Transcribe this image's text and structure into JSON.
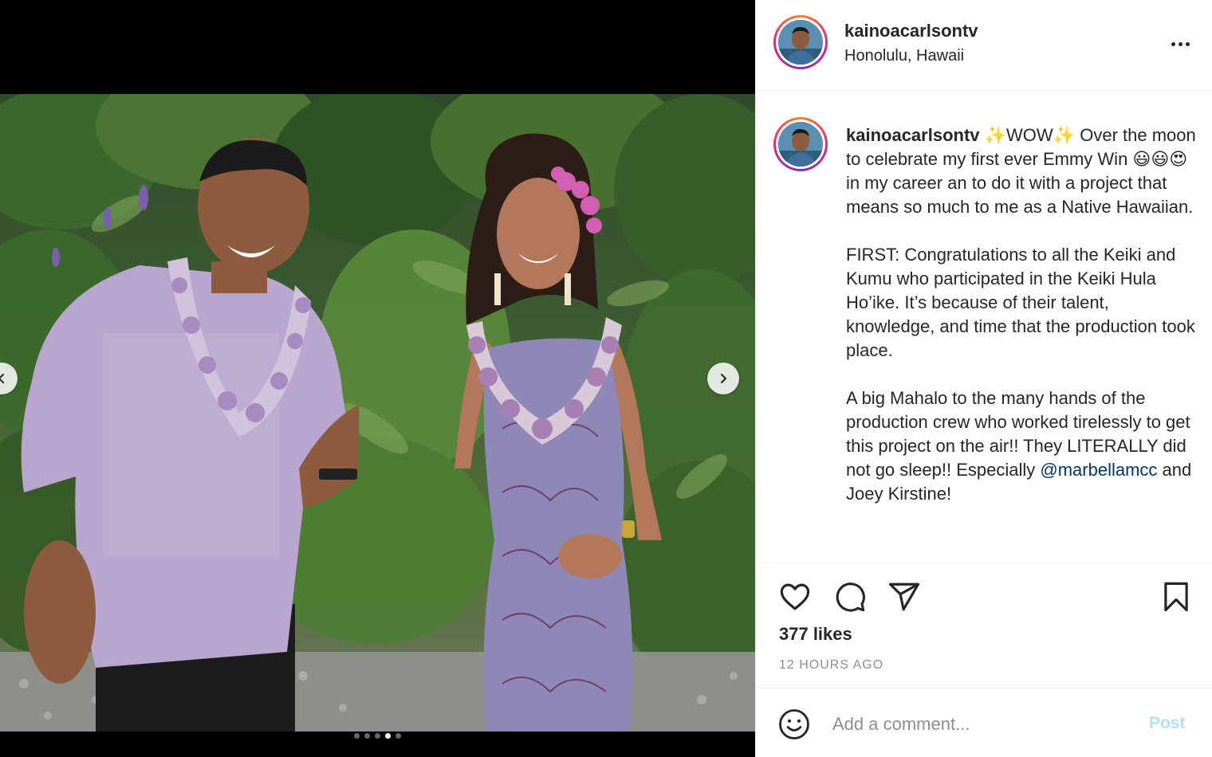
{
  "post": {
    "username": "kainoacarlsontv",
    "location": "Honolulu, Hawaii",
    "media": {
      "carousel_count": 5,
      "active_index": 3
    },
    "caption": {
      "author": "kainoacarlsontv",
      "sparkle": "✨",
      "line1_word": "WOW",
      "line1_rest": " Over the moon to celebrate my first ever Emmy Win ",
      "line1_emojis": "😃😃😍",
      "line1_end": " in my career an to do it with a project that means so much to me as a Native Hawaiian.",
      "para2": "FIRST: Congratulations to all the Keiki and Kumu who participated in the Keiki Hula Ho’ike. It’s because of their talent, knowledge, and time that the production took place.",
      "para3_start": "A big Mahalo to the many hands of the production crew who worked tirelessly to get this project on the air!! They LITERALLY did not go sleep!! Especially ",
      "mention": "@marbellamcc",
      "para3_end": " and Joey Kirstine!"
    },
    "likes": "377 likes",
    "time_ago": "12 HOURS AGO",
    "comment": {
      "placeholder": "Add a comment...",
      "post_label": "Post"
    },
    "icons": {
      "more": "more-options-icon",
      "like": "heart-icon",
      "comment": "comment-icon",
      "share": "share-icon",
      "save": "bookmark-icon",
      "emoji": "emoji-icon",
      "prev": "chevron-left-icon",
      "next": "chevron-right-icon"
    },
    "colors": {
      "link": "#00376b",
      "post_disabled": "#b2dffc",
      "muted": "#8e8e8e"
    }
  }
}
